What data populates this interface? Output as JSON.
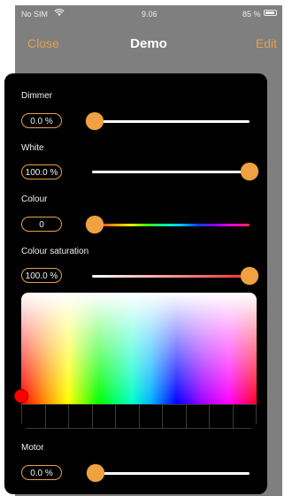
{
  "status_bar": {
    "carrier": "No SIM",
    "time": "9.06",
    "battery_percent": "85 %",
    "icons": [
      "wifi-icon",
      "battery-icon"
    ]
  },
  "nav": {
    "close_label": "Close",
    "title": "Demo",
    "edit_label": "Edit"
  },
  "controls": {
    "dimmer": {
      "label": "Dimmer",
      "value": "0.0 %",
      "level": 0.0
    },
    "white": {
      "label": "White",
      "value": "100.0 %",
      "level": 1.0
    },
    "colour": {
      "label": "Colour",
      "value": "0",
      "level": 0.0
    },
    "colour_saturation": {
      "label": "Colour saturation",
      "value": "100.0 %",
      "level": 1.0
    },
    "motor": {
      "label": "Motor",
      "value": "0.0 %",
      "level": 0.0
    }
  },
  "colors": {
    "accent": "#f0a141",
    "sheet_background": "#000000",
    "header_background": "#7f7f80"
  }
}
